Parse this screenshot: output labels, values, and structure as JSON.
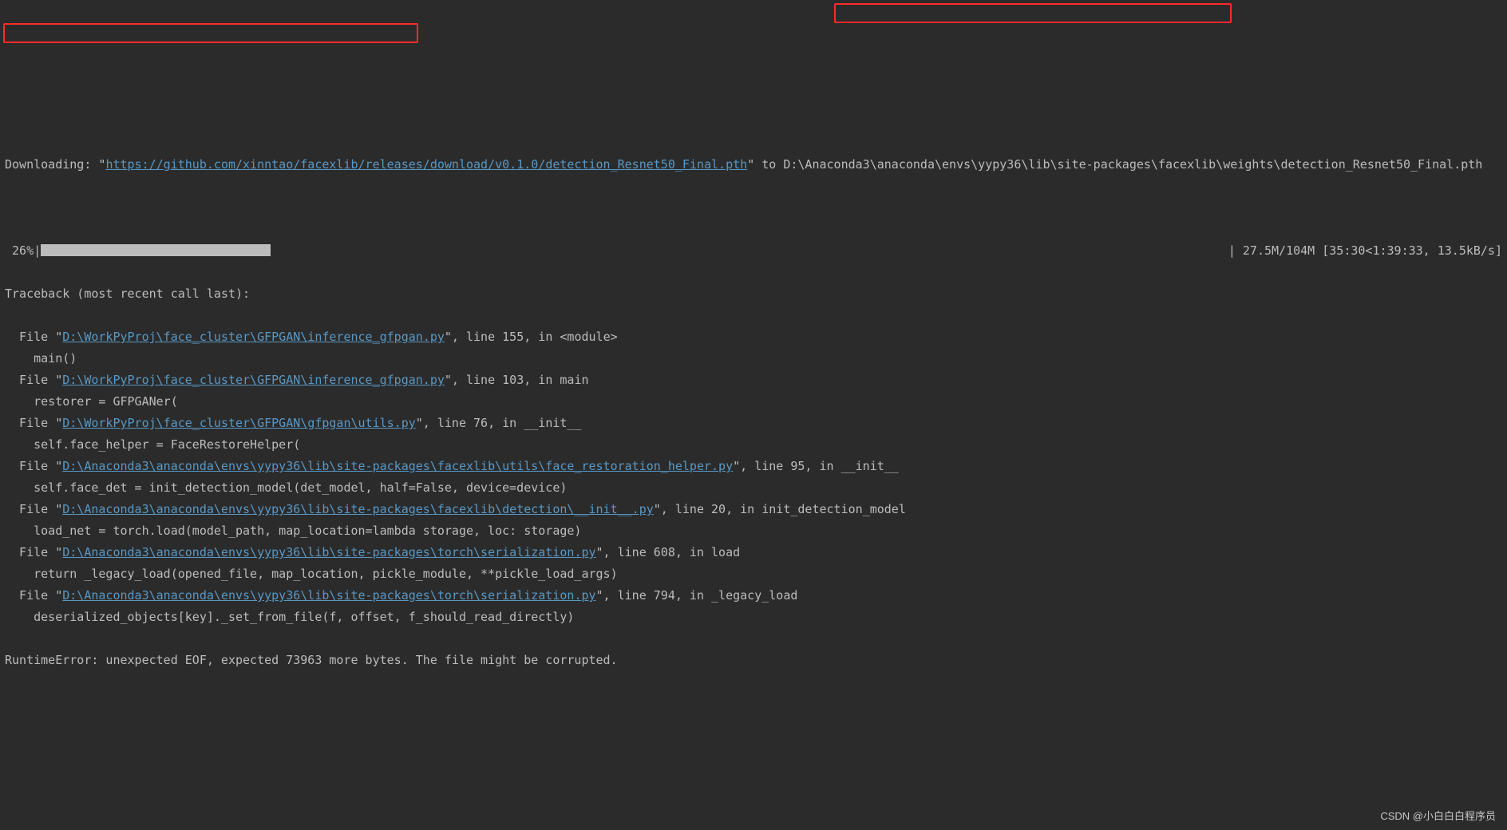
{
  "download": {
    "prefix": "Downloading: \"",
    "url": "https://github.com/xinntao/facexlib/releases/download/v0.1.0/detection_Resnet50_Final.pth",
    "midquote": "\" to ",
    "dest": "D:\\Anaconda3\\anaconda\\envs\\yypy36\\lib\\site-packages\\facexlib\\weights\\detection_Resnet50_Final.pth"
  },
  "progress": {
    "percent": " 26%|",
    "stats": "| 27.5M/104M [35:30<1:39:33, 13.5kB/s]"
  },
  "traceback": {
    "header": "Traceback (most recent call last):",
    "frames": [
      {
        "file_prefix": "  File \"",
        "path": "D:\\WorkPyProj\\face_cluster\\GFPGAN\\inference_gfpgan.py",
        "suffix": "\", line 155, in <module>",
        "code": "    main()"
      },
      {
        "file_prefix": "  File \"",
        "path": "D:\\WorkPyProj\\face_cluster\\GFPGAN\\inference_gfpgan.py",
        "suffix": "\", line 103, in main",
        "code": "    restorer = GFPGANer("
      },
      {
        "file_prefix": "  File \"",
        "path": "D:\\WorkPyProj\\face_cluster\\GFPGAN\\gfpgan\\utils.py",
        "suffix": "\", line 76, in __init__",
        "code": "    self.face_helper = FaceRestoreHelper("
      },
      {
        "file_prefix": "  File \"",
        "path": "D:\\Anaconda3\\anaconda\\envs\\yypy36\\lib\\site-packages\\facexlib\\utils\\face_restoration_helper.py",
        "suffix": "\", line 95, in __init__",
        "code": "    self.face_det = init_detection_model(det_model, half=False, device=device)"
      },
      {
        "file_prefix": "  File \"",
        "path": "D:\\Anaconda3\\anaconda\\envs\\yypy36\\lib\\site-packages\\facexlib\\detection\\__init__.py",
        "suffix": "\", line 20, in init_detection_model",
        "code": "    load_net = torch.load(model_path, map_location=lambda storage, loc: storage)"
      },
      {
        "file_prefix": "  File \"",
        "path": "D:\\Anaconda3\\anaconda\\envs\\yypy36\\lib\\site-packages\\torch\\serialization.py",
        "suffix": "\", line 608, in load",
        "code": "    return _legacy_load(opened_file, map_location, pickle_module, **pickle_load_args)"
      },
      {
        "file_prefix": "  File \"",
        "path": "D:\\Anaconda3\\anaconda\\envs\\yypy36\\lib\\site-packages\\torch\\serialization.py",
        "suffix": "\", line 794, in _legacy_load",
        "code": "    deserialized_objects[key]._set_from_file(f, offset, f_should_read_directly)"
      }
    ],
    "error": "RuntimeError: unexpected EOF, expected 73963 more bytes. The file might be corrupted."
  },
  "watermark": "CSDN @小白白白程序员"
}
